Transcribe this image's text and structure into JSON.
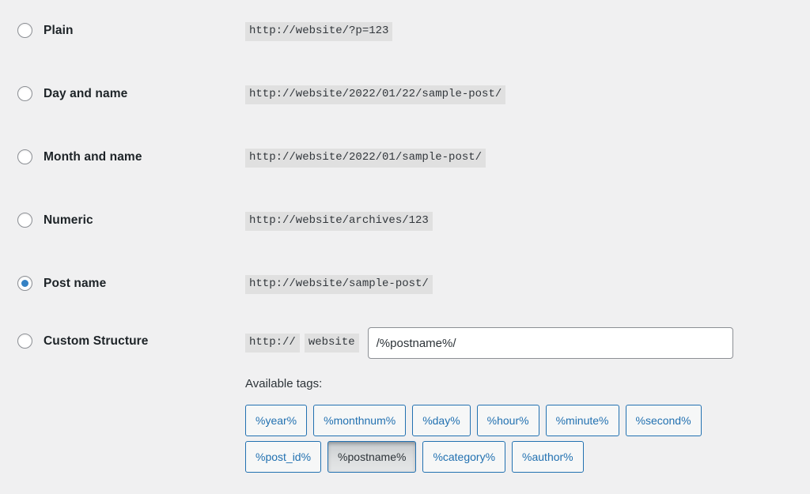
{
  "colors": {
    "page_background": "#f0f0f1",
    "label_text": "#1d2327",
    "code_background": "#e0e0e0",
    "code_text": "#32373c",
    "radio_accent": "#3582c4",
    "tag_border": "#2271b1",
    "tag_text": "#2271b1",
    "tag_active_background": "#dcdedf"
  },
  "permalink_options": [
    {
      "id": "plain",
      "label": "Plain",
      "example": "http://website/?p=123",
      "selected": false
    },
    {
      "id": "day-and-name",
      "label": "Day and name",
      "example": "http://website/2022/01/22/sample-post/",
      "selected": false
    },
    {
      "id": "month-and-name",
      "label": "Month and name",
      "example": "http://website/2022/01/sample-post/",
      "selected": false
    },
    {
      "id": "numeric",
      "label": "Numeric",
      "example": "http://website/archives/123",
      "selected": false
    },
    {
      "id": "post-name",
      "label": "Post name",
      "example": "http://website/sample-post/",
      "selected": true
    }
  ],
  "custom_structure": {
    "label": "Custom Structure",
    "selected": false,
    "protocol_prefix": "http://",
    "site_name": "website",
    "input_value": "/%postname%/",
    "input_placeholder": "",
    "available_tags_label": "Available tags:",
    "tag_rows": [
      [
        {
          "label": "%year%",
          "active": false
        },
        {
          "label": "%monthnum%",
          "active": false
        },
        {
          "label": "%day%",
          "active": false
        },
        {
          "label": "%hour%",
          "active": false
        },
        {
          "label": "%minute%",
          "active": false
        },
        {
          "label": "%second%",
          "active": false
        }
      ],
      [
        {
          "label": "%post_id%",
          "active": false
        },
        {
          "label": "%postname%",
          "active": true
        },
        {
          "label": "%category%",
          "active": false
        },
        {
          "label": "%author%",
          "active": false
        }
      ]
    ]
  }
}
